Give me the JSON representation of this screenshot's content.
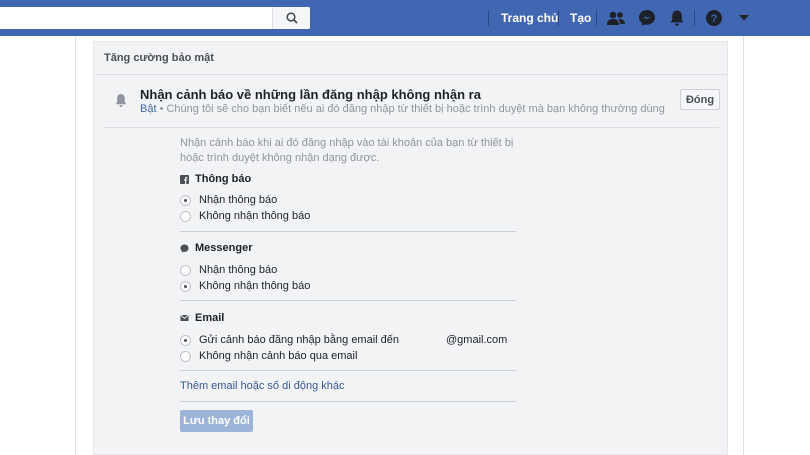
{
  "topbar": {
    "search_placeholder": "",
    "nav_home": "Trang chủ",
    "nav_create": "Tạo"
  },
  "panel": {
    "title": "Tăng cường bảo mật"
  },
  "setting": {
    "title": "Nhận cảnh báo về những lần đăng nhập không nhận ra",
    "status": "Bật",
    "description": " • Chúng tôi sẽ cho bạn biết nếu ai đó đăng nhập từ thiết bị hoặc trình duyệt mà bạn không thường dùng",
    "close_label": "Đóng"
  },
  "intro": "Nhận cảnh báo khi ai đó đăng nhập vào tài khoản của bạn từ thiết bị hoặc trình duyệt không nhận dạng được.",
  "sections": {
    "notifications": {
      "title": "Thông báo",
      "icon": "facebook-icon",
      "options": [
        "Nhận thông báo",
        "Không nhận thông báo"
      ],
      "selected": 0
    },
    "messenger": {
      "title": "Messenger",
      "icon": "messenger-icon",
      "options": [
        "Nhận thông báo",
        "Không nhận thông báo"
      ],
      "selected": 1
    },
    "email": {
      "title": "Email",
      "icon": "envelope-icon",
      "options": [
        "Gửi cảnh báo đăng nhập bằng email đến",
        "Không nhận cảnh báo qua email"
      ],
      "email_suffix": "@gmail.com",
      "selected": 0
    }
  },
  "add_link": "Thêm email hoặc số di động khác",
  "save_label": "Lưu thay đổi",
  "colors": {
    "brand": "#4267b2",
    "link": "#385898",
    "save_disabled": "#9cb4d8"
  }
}
